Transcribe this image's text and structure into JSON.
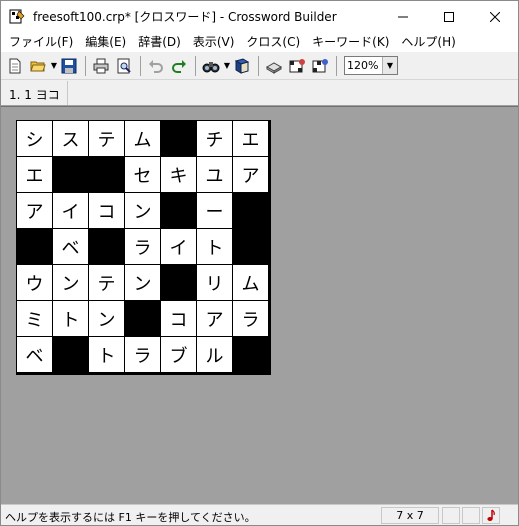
{
  "window": {
    "title": "freesoft100.crp* [クロスワード] - Crossword Builder",
    "minimize_glyph": "─",
    "maximize_glyph": "☐",
    "close_glyph": "✕"
  },
  "menu": {
    "items": [
      "ファイル(F)",
      "編集(E)",
      "辞書(D)",
      "表示(V)",
      "クロス(C)",
      "キーワード(K)",
      "ヘルプ(H)"
    ]
  },
  "toolbar": {
    "zoom_value": "120%",
    "icons": [
      "new-icon",
      "open-icon",
      "save-icon",
      "print-icon",
      "print-preview-icon",
      "undo-icon",
      "redo-icon",
      "find-icon",
      "dictionary-icon",
      "erase-icon",
      "grid-build-icon",
      "grid-build2-icon"
    ]
  },
  "infobar": {
    "current_clue": "1. 1 ヨコ"
  },
  "grid": {
    "rows": [
      [
        "シ",
        "ス",
        "テ",
        "ム",
        "#",
        "チ",
        "エ"
      ],
      [
        "エ",
        "#",
        "#",
        "セ",
        "キ",
        "ユ",
        "ア"
      ],
      [
        "ア",
        "イ",
        "コ",
        "ン",
        "#",
        "ー",
        "#"
      ],
      [
        "#",
        "ベ",
        "#",
        "ラ",
        "イ",
        "ト",
        "#"
      ],
      [
        "ウ",
        "ン",
        "テ",
        "ン",
        "#",
        "リ",
        "ム"
      ],
      [
        "ミ",
        "ト",
        "ン",
        "#",
        "コ",
        "ア",
        "ラ"
      ],
      [
        "ベ",
        "#",
        "ト",
        "ラ",
        "ブ",
        "ル",
        "#"
      ]
    ]
  },
  "statusbar": {
    "help_text": "ヘルプを表示するには F1 キーを押してください。",
    "grid_size": "7 x 7"
  },
  "colors": {
    "canvas": "#a0a0a0",
    "black_cell": "#000000",
    "white_cell": "#ffffff"
  }
}
